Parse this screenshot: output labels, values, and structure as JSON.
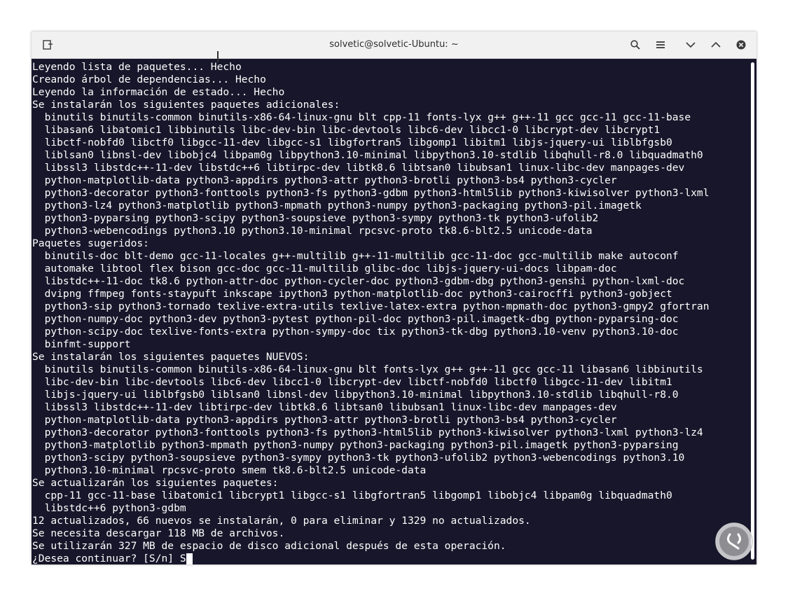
{
  "window": {
    "title": "solvetic@solvetic-Ubuntu: ~",
    "icons": {
      "new_tab": "new-tab-icon",
      "search": "search-icon",
      "menu": "hamburger-menu-icon",
      "minimize": "chevron-down-icon",
      "maximize": "chevron-up-icon",
      "close": "close-icon"
    }
  },
  "colors": {
    "terminal_background": "#17162a",
    "terminal_text": "#ffffff",
    "titlebar": "#f1f1f1"
  },
  "terminal": {
    "lines": [
      "Leyendo lista de paquetes... Hecho",
      "Creando árbol de dependencias... Hecho",
      "Leyendo la información de estado... Hecho",
      "Se instalarán los siguientes paquetes adicionales:",
      "  binutils binutils-common binutils-x86-64-linux-gnu blt cpp-11 fonts-lyx g++ g++-11 gcc gcc-11 gcc-11-base",
      "  libasan6 libatomic1 libbinutils libc-dev-bin libc-devtools libc6-dev libcc1-0 libcrypt-dev libcrypt1",
      "  libctf-nobfd0 libctf0 libgcc-11-dev libgcc-s1 libgfortran5 libgomp1 libitm1 libjs-jquery-ui liblbfgsb0",
      "  liblsan0 libnsl-dev libobjc4 libpam0g libpython3.10-minimal libpython3.10-stdlib libqhull-r8.0 libquadmath0",
      "  libssl3 libstdc++-11-dev libstdc++6 libtirpc-dev libtk8.6 libtsan0 libubsan1 linux-libc-dev manpages-dev",
      "  python-matplotlib-data python3-appdirs python3-attr python3-brotli python3-bs4 python3-cycler",
      "  python3-decorator python3-fonttools python3-fs python3-gdbm python3-html5lib python3-kiwisolver python3-lxml",
      "  python3-lz4 python3-matplotlib python3-mpmath python3-numpy python3-packaging python3-pil.imagetk",
      "  python3-pyparsing python3-scipy python3-soupsieve python3-sympy python3-tk python3-ufolib2",
      "  python3-webencodings python3.10 python3.10-minimal rpcsvc-proto tk8.6-blt2.5 unicode-data",
      "Paquetes sugeridos:",
      "  binutils-doc blt-demo gcc-11-locales g++-multilib g++-11-multilib gcc-11-doc gcc-multilib make autoconf",
      "  automake libtool flex bison gcc-doc gcc-11-multilib glibc-doc libjs-jquery-ui-docs libpam-doc",
      "  libstdc++-11-doc tk8.6 python-attr-doc python-cycler-doc python3-gdbm-dbg python3-genshi python-lxml-doc",
      "  dvipng ffmpeg fonts-staypuft inkscape ipython3 python-matplotlib-doc python3-cairocffi python3-gobject",
      "  python3-sip python3-tornado texlive-extra-utils texlive-latex-extra python-mpmath-doc python3-gmpy2 gfortran",
      "  python-numpy-doc python3-dev python3-pytest python-pil-doc python3-pil.imagetk-dbg python-pyparsing-doc",
      "  python-scipy-doc texlive-fonts-extra python-sympy-doc tix python3-tk-dbg python3.10-venv python3.10-doc",
      "  binfmt-support",
      "Se instalarán los siguientes paquetes NUEVOS:",
      "  binutils binutils-common binutils-x86-64-linux-gnu blt fonts-lyx g++ g++-11 gcc gcc-11 libasan6 libbinutils",
      "  libc-dev-bin libc-devtools libc6-dev libcc1-0 libcrypt-dev libctf-nobfd0 libctf0 libgcc-11-dev libitm1",
      "  libjs-jquery-ui liblbfgsb0 liblsan0 libnsl-dev libpython3.10-minimal libpython3.10-stdlib libqhull-r8.0",
      "  libssl3 libstdc++-11-dev libtirpc-dev libtk8.6 libtsan0 libubsan1 linux-libc-dev manpages-dev",
      "  python-matplotlib-data python3-appdirs python3-attr python3-brotli python3-bs4 python3-cycler",
      "  python3-decorator python3-fonttools python3-fs python3-html5lib python3-kiwisolver python3-lxml python3-lz4",
      "  python3-matplotlib python3-mpmath python3-numpy python3-packaging python3-pil.imagetk python3-pyparsing",
      "  python3-scipy python3-soupsieve python3-sympy python3-tk python3-ufolib2 python3-webencodings python3.10",
      "  python3.10-minimal rpcsvc-proto smem tk8.6-blt2.5 unicode-data",
      "Se actualizarán los siguientes paquetes:",
      "  cpp-11 gcc-11-base libatomic1 libcrypt1 libgcc-s1 libgfortran5 libgomp1 libobjc4 libpam0g libquadmath0",
      "  libstdc++6 python3-gdbm",
      "12 actualizados, 66 nuevos se instalarán, 0 para eliminar y 1329 no actualizados.",
      "Se necesita descargar 118 MB de archivos.",
      "Se utilizarán 327 MB de espacio de disco adicional después de esta operación."
    ],
    "prompt": "¿Desea continuar? [S/n] S"
  }
}
